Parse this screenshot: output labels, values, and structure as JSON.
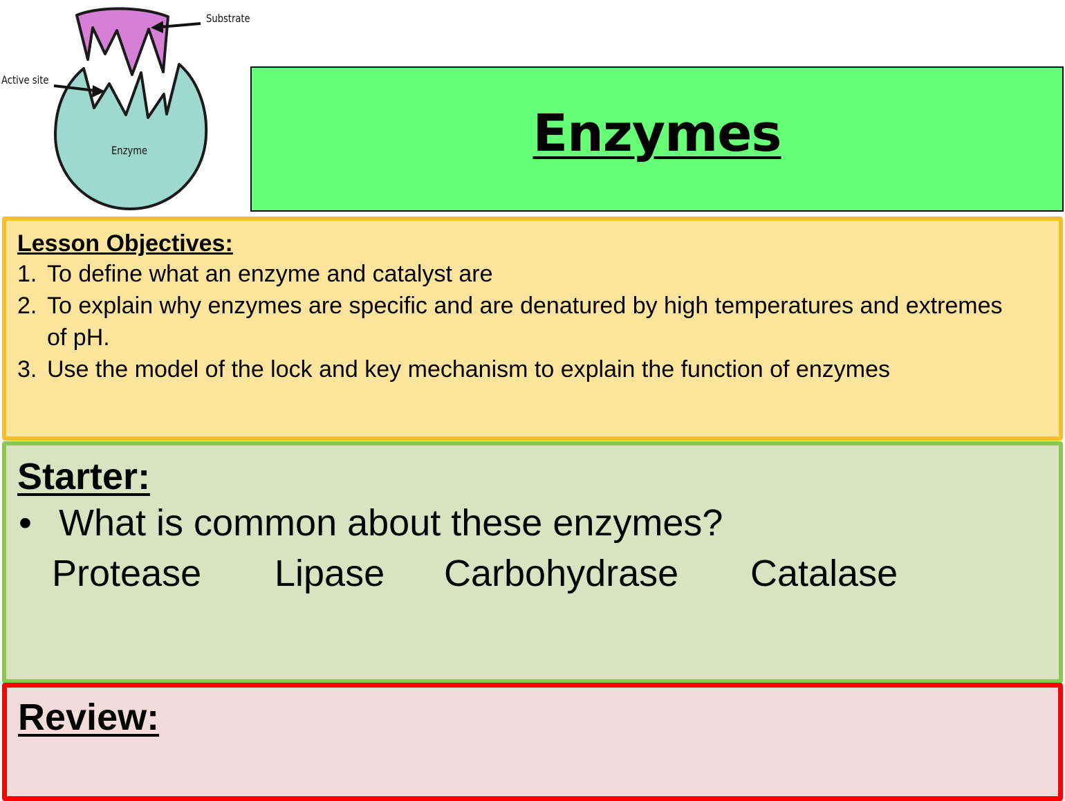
{
  "diagram": {
    "substrate_label": "Substrate",
    "active_site_label": "Active site",
    "enzyme_label": "Enzyme",
    "colors": {
      "substrate": "#d67fd6",
      "enzyme": "#9ed9cf"
    }
  },
  "title": {
    "text": "Enzymes",
    "background": "#66ff77"
  },
  "objectives": {
    "heading": "Lesson Objectives:",
    "items": [
      {
        "number": "1.",
        "text": "To define what an enzyme and catalyst are"
      },
      {
        "number": "2.",
        "text": "To explain why enzymes are specific and are denatured by high temperatures and extremes of pH."
      },
      {
        "number": "3.",
        "text": "Use the model of the lock and key mechanism to explain the function of enzymes"
      }
    ],
    "background": "#fee49c",
    "border": "#f8bf2d"
  },
  "starter": {
    "heading": "Starter:",
    "bullet": "•",
    "question": "What is common about these enzymes?",
    "enzymes": [
      "Protease",
      "Lipase",
      "Carbohydrase",
      "Catalase"
    ],
    "background": "#d9e3c1",
    "border": "#8ac94f"
  },
  "review": {
    "heading": "Review:",
    "background": "#f2dcdb",
    "border": "#ff0000"
  }
}
